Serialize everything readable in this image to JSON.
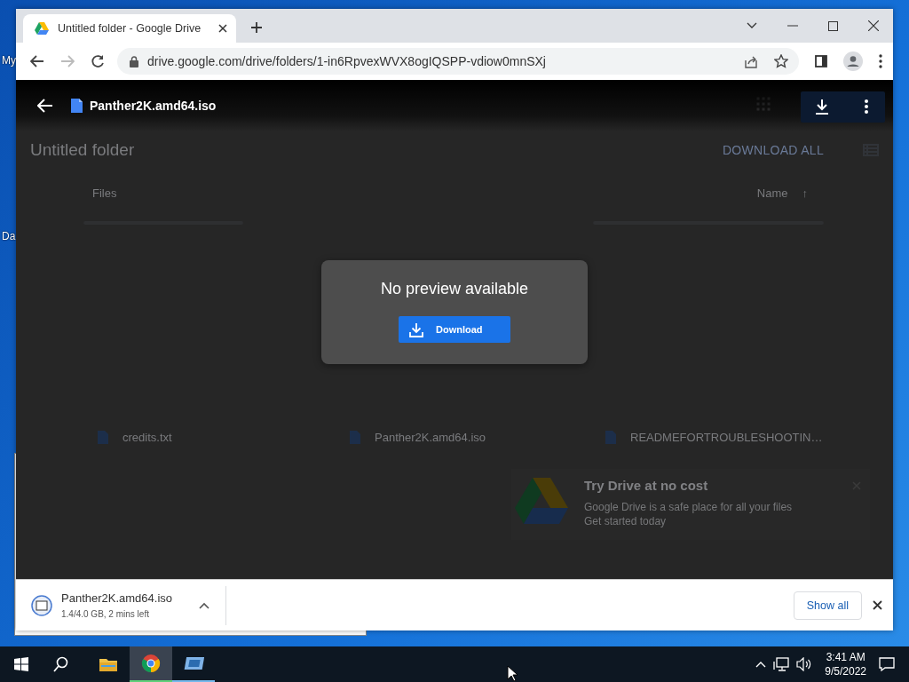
{
  "desktop": {
    "icons": [
      {
        "label": "My"
      },
      {
        "label": "Da"
      }
    ]
  },
  "browser": {
    "tab": {
      "title": "Untitled folder - Google Drive",
      "selected": true
    },
    "address": "drive.google.com/drive/folders/1-in6RpvexWVX8ogIQSPP-vdiow0mnSXj"
  },
  "drive_page": {
    "title": "Untitled folder",
    "download_all": "DOWNLOAD ALL",
    "files_heading": "Files",
    "sort_label": "Name",
    "sort_arrow": "↑",
    "files": [
      {
        "name": "credits.txt"
      },
      {
        "name": "Panther2K.amd64.iso"
      },
      {
        "name": "READMEFORTROUBLESHOOTIN…"
      }
    ],
    "promo": {
      "title": "Try Drive at no cost",
      "text": "Google Drive is a safe place for all your files",
      "link": "Get started today"
    }
  },
  "viewer": {
    "file_name": "Panther2K.amd64.iso",
    "message": "No preview available",
    "download_button": "Download"
  },
  "download_shelf": {
    "file_name": "Panther2K.amd64.iso",
    "progress": "1.4/4.0 GB, 2 mins left",
    "show_all": "Show all"
  },
  "taskbar": {
    "apps": [
      {
        "kind": "folder",
        "selected": false,
        "running": false
      },
      {
        "kind": "chrome",
        "selected": true,
        "running": true
      },
      {
        "kind": "app",
        "selected": false,
        "running": true
      }
    ],
    "time": "3:41 AM",
    "date": "9/5/2022"
  }
}
